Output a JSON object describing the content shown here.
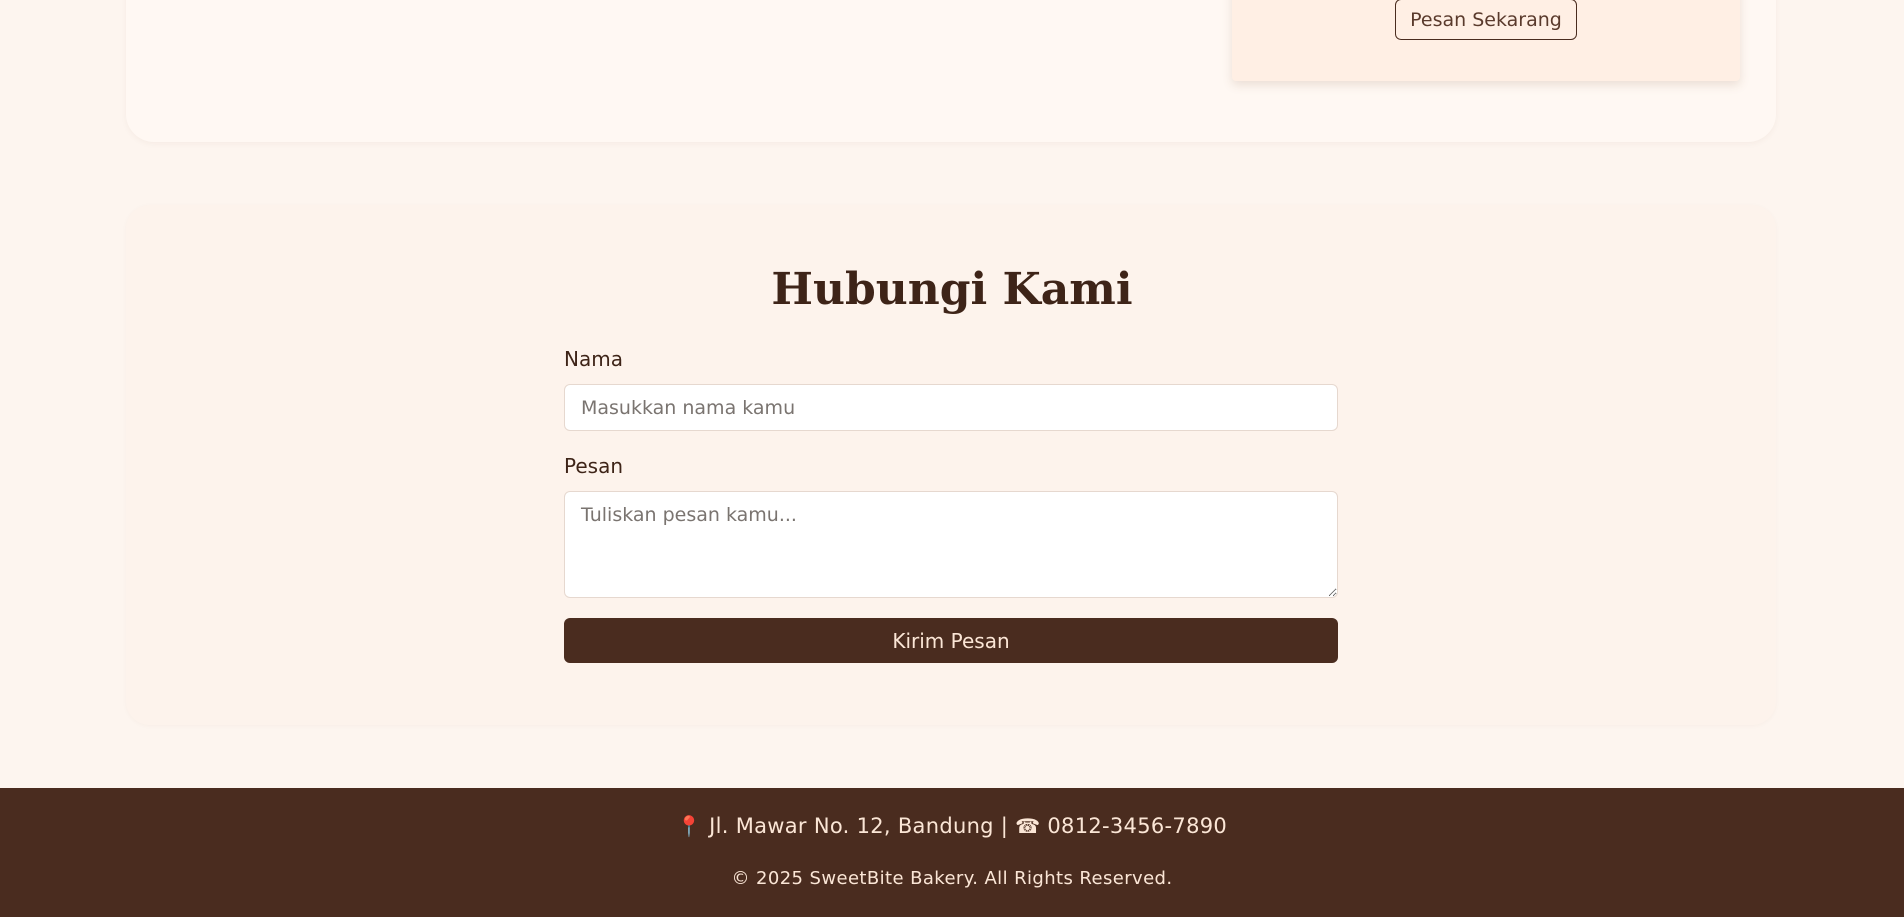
{
  "product_card": {
    "order_button_label": "Pesan Sekarang"
  },
  "contact": {
    "title": "Hubungi Kami",
    "name_label": "Nama",
    "name_placeholder": "Masukkan nama kamu",
    "name_value": "",
    "message_label": "Pesan",
    "message_placeholder": "Tuliskan pesan kamu...",
    "message_value": "",
    "submit_label": "Kirim Pesan"
  },
  "footer": {
    "pin_icon": "📍",
    "address": "Jl. Mawar No. 12, Bandung",
    "separator": "|",
    "phone_icon": "☎",
    "phone": "0812-3456-7890",
    "copyright": "© 2025 SweetBite Bakery. All Rights Reserved."
  },
  "colors": {
    "page_background": "#fdf5ef",
    "brand_brown": "#4a2c1f",
    "card_peach": "#ffefe4",
    "footer_text": "#fbe6d6"
  },
  "icons": {
    "location": "location-pin-icon",
    "phone": "phone-icon"
  }
}
